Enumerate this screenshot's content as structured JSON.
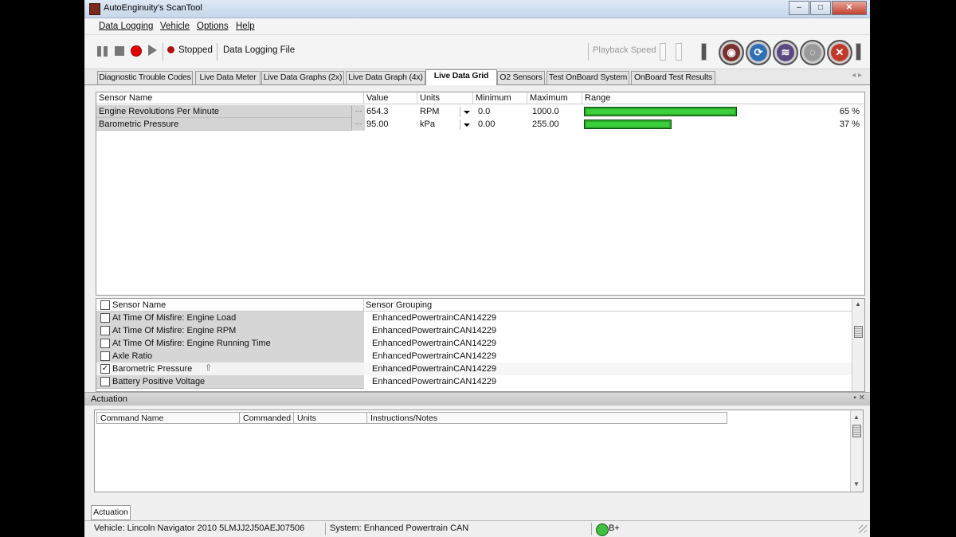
{
  "window": {
    "title": "AutoEnginuity's ScanTool",
    "controls": {
      "minimize": "–",
      "maximize": "□",
      "close": "✕"
    }
  },
  "menu": [
    "Data Logging",
    "Vehicle",
    "Options",
    "Help"
  ],
  "toolbar": {
    "status": "Stopped",
    "data_logging_file": "Data Logging File",
    "playback_speed": "Playback Speed",
    "round_buttons": [
      "button-1",
      "button-2",
      "button-3",
      "button-4",
      "button-5"
    ]
  },
  "tabs": [
    {
      "label": "Diagnostic Trouble Codes",
      "active": false
    },
    {
      "label": "Live Data Meter",
      "active": false
    },
    {
      "label": "Live Data Graphs (2x)",
      "active": false
    },
    {
      "label": "Live Data Graph (4x)",
      "active": false
    },
    {
      "label": "Live Data Grid",
      "active": true
    },
    {
      "label": "O2 Sensors",
      "active": false
    },
    {
      "label": "Test OnBoard System",
      "active": false
    },
    {
      "label": "OnBoard Test Results",
      "active": false
    }
  ],
  "tab_arrows": "◂ ▸",
  "grid": {
    "headers": [
      "Sensor Name",
      "Value",
      "Units",
      "Minimum",
      "Maximum",
      "Range"
    ],
    "ellipsis": "···",
    "rows": [
      {
        "name": "Engine Revolutions Per Minute",
        "value": "654.3",
        "units": "RPM",
        "minimum": "0.0",
        "maximum": "1000.0",
        "range_fraction": 0.65,
        "percent": "65 %"
      },
      {
        "name": "Barometric Pressure",
        "value": "95.00",
        "units": "kPa",
        "minimum": "0.00",
        "maximum": "255.00",
        "range_fraction": 0.37,
        "percent": "37 %"
      }
    ]
  },
  "sensor_list": {
    "headers": [
      "Sensor Name",
      "Sensor Grouping"
    ],
    "rows": [
      {
        "name": "At Time Of Misfire: Engine Load",
        "group": "EnhancedPowertrainCAN14229",
        "checked": false
      },
      {
        "name": "At Time Of Misfire: Engine RPM",
        "group": "EnhancedPowertrainCAN14229",
        "checked": false
      },
      {
        "name": "At Time Of Misfire: Engine Running Time",
        "group": "EnhancedPowertrainCAN14229",
        "checked": false
      },
      {
        "name": "Axle Ratio",
        "group": "EnhancedPowertrainCAN14229",
        "checked": false
      },
      {
        "name": "Barometric Pressure",
        "group": "EnhancedPowertrainCAN14229",
        "checked": true
      },
      {
        "name": "Battery Positive Voltage",
        "group": "EnhancedPowertrainCAN14229",
        "checked": false
      }
    ]
  },
  "actuation": {
    "title": "Actuation",
    "controls": "▪ ✕",
    "headers": [
      "Command Name",
      "Commanded",
      "Units",
      "Instructions/Notes"
    ],
    "tab": "Actuation"
  },
  "statusbar": {
    "vehicle": "Vehicle: Lincoln  Navigator  2010  5LMJJ2J50AEJ07506",
    "system": "System: Enhanced Powertrain CAN",
    "connection": "B+"
  },
  "colors": {
    "bar_fill": "#3ccf3c",
    "record": "#e00000"
  }
}
